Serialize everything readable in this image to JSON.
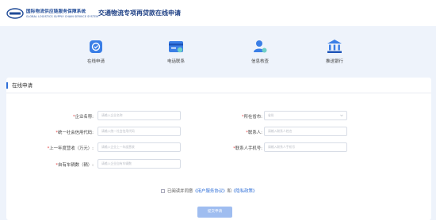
{
  "header": {
    "org_name_cn": "国际物流供应链服务保障系统",
    "org_name_en": "GLOBAL LOGISTICS SUPPLY CHAIN SERVICE SYSTEM",
    "title": "交通物流专项再贷款在线申请"
  },
  "nav": [
    {
      "label": "在线申请",
      "icon": "online-apply-icon"
    },
    {
      "label": "电话联系",
      "icon": "phone-contact-icon"
    },
    {
      "label": "信息核查",
      "icon": "info-check-icon"
    },
    {
      "label": "推送银行",
      "icon": "bank-icon"
    }
  ],
  "form": {
    "section_title": "在线申请",
    "fields": {
      "company_name": {
        "label": "企业名称:",
        "placeholder": "请输入企业名称"
      },
      "province_city": {
        "label": "所在省市:",
        "placeholder": "省份"
      },
      "credit_code": {
        "label": "统一社会信用代码:",
        "placeholder": "请输入统一社会信用代码"
      },
      "contact": {
        "label": "联系人:",
        "placeholder": "请输入联系人姓名"
      },
      "revenue": {
        "label": "上一年度营收（万元）:",
        "placeholder": "请输入企业上一年度营收"
      },
      "contact_phone": {
        "label": "联系人手机号:",
        "placeholder": "请输入联系人手机号"
      },
      "vehicles": {
        "label": "自有车辆数（辆）:",
        "placeholder": "请输入企业自有车辆数"
      }
    },
    "agreement": {
      "prefix": "已阅读并同意",
      "terms": "《用户服务协议》",
      "and": "和",
      "privacy": "《隐私政策》"
    },
    "submit_label": "提交申请"
  },
  "colors": {
    "accent": "#2f6fd8",
    "brand_dark": "#1d3f84",
    "required": "#e23b3b",
    "submit_bg": "#9fbdf0",
    "page_bg": "#eef3fb"
  }
}
